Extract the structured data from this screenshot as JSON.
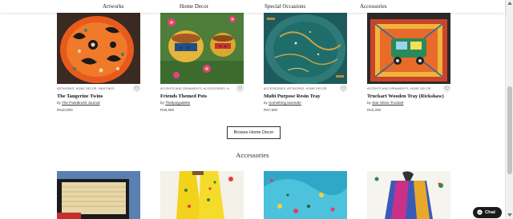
{
  "nav": {
    "items": [
      "Artworks",
      "Home Decor",
      "Special Occasions",
      "Accessories"
    ]
  },
  "products": [
    {
      "categories": "ARTWORKS, HOME DECOR, PAINTINGS",
      "title": "The Tangerine Twins",
      "by_label": "by",
      "seller": "The Paintbrush Journal",
      "price": "Rs10,000"
    },
    {
      "categories": "ACCENTS AND ORNAMENTS, ACCESSORIES, H...",
      "title": "Friends Themed Pots",
      "by_label": "by",
      "seller": "Thetipsypalette",
      "price": "Rs6,500"
    },
    {
      "categories": "ACCESSORIES, ARTWORKS, HOME DECOR",
      "title": "Multi Purpose Resin Tray",
      "by_label": "by",
      "seller": "Something lavender",
      "price": "Rs7,500"
    },
    {
      "categories": "ACCENTS AND ORNAMENTS, HOME DECOR",
      "title": "Truckart Wooden Tray (Rickshaw)",
      "by_label": "by",
      "seller": "Star Shine Truckart",
      "price": "Rs2,200"
    }
  ],
  "browse_button": "Browse Home Decor",
  "accessories_section": {
    "title": "Accessories"
  },
  "chat": {
    "label": "Chat"
  },
  "colors": {
    "accent": "#1b1b1b",
    "text": "#222222",
    "button_border": "#333333"
  }
}
